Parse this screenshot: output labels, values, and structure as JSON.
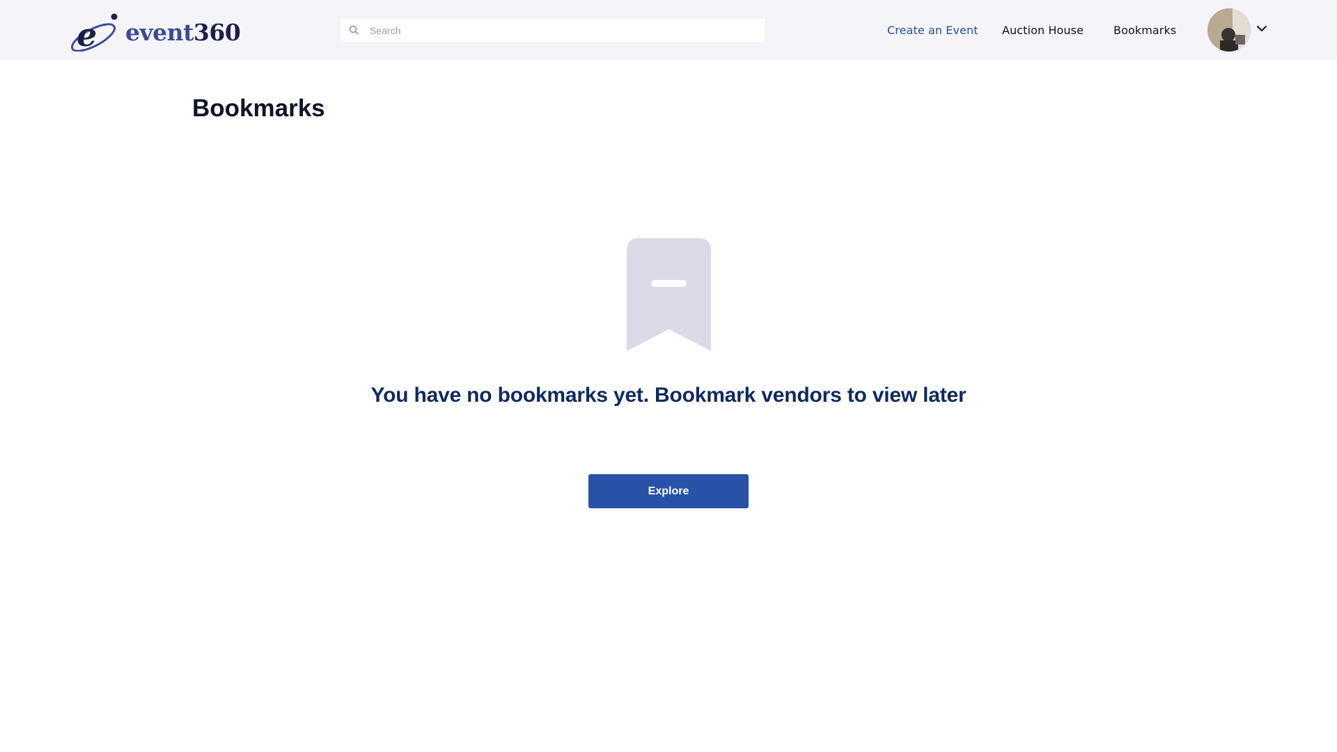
{
  "header": {
    "logo": {
      "text_main": "event",
      "text_num": "360",
      "mark": "e"
    },
    "search": {
      "placeholder": "Search",
      "value": ""
    },
    "nav": {
      "create_event": "Create an Event",
      "auction_house": "Auction House",
      "bookmarks": "Bookmarks"
    },
    "icons": {
      "search": "search-icon",
      "chevron": "chevron-down-icon",
      "avatar": "avatar"
    }
  },
  "main": {
    "title": "Bookmarks",
    "empty_state": {
      "icon": "bookmark-icon",
      "message": "You have no bookmarks yet. Bookmark vendors to view later",
      "button_label": "Explore"
    }
  },
  "colors": {
    "header_bg": "#f5f5f9",
    "active_nav": "#2b4fa0",
    "primary_button": "#2851a8",
    "message_text": "#0f2a5e",
    "bookmark_fill": "#dadae9"
  }
}
